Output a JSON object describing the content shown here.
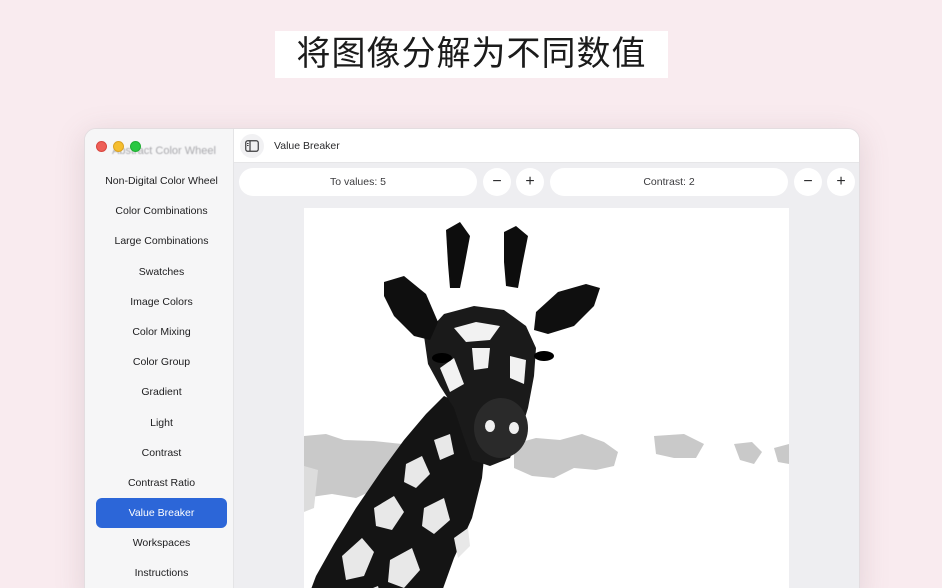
{
  "headline": "将图像分解为不同数值",
  "window": {
    "ghost_title": "Abstract Color Wheel",
    "title": "Value Breaker"
  },
  "sidebar": {
    "items": [
      {
        "label": "Non-Digital Color Wheel"
      },
      {
        "label": "Color Combinations"
      },
      {
        "label": "Large Combinations"
      },
      {
        "label": "Swatches"
      },
      {
        "label": "Image Colors"
      },
      {
        "label": "Color Mixing"
      },
      {
        "label": "Color Group"
      },
      {
        "label": "Gradient"
      },
      {
        "label": "Light"
      },
      {
        "label": "Contrast"
      },
      {
        "label": "Contrast Ratio"
      },
      {
        "label": "Value Breaker",
        "active": true
      },
      {
        "label": "Workspaces"
      },
      {
        "label": "Instructions"
      }
    ]
  },
  "toolbar": {
    "values_label": "To values: 5",
    "contrast_label": "Contrast: 2",
    "minus": "−",
    "plus": "+"
  },
  "colors": {
    "accent": "#2c66d8",
    "background": "#f9ebef"
  },
  "icons": {
    "sidebar_toggle": "sidebar-toggle-icon",
    "image": "giraffe-image"
  }
}
